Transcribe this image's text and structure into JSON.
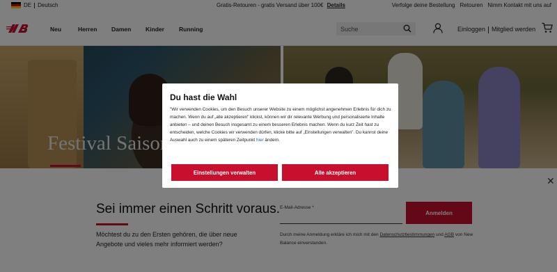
{
  "topbar": {
    "lang_code": "DE",
    "lang_name": "Deutsch",
    "promo_text": "Gratis-Retouren - gratis Versand über 100€",
    "promo_link": "Details",
    "utility": [
      "Verfolge deine Bestellung",
      "Retouren",
      "Nimm Kontakt mit uns auf"
    ]
  },
  "nav": {
    "logo_icon": "new-balance-logo",
    "links": [
      "Neu",
      "Herren",
      "Damen",
      "Kinder",
      "Running"
    ],
    "search_placeholder": "Suche",
    "login": "Einloggen",
    "register": "Mitglied werden"
  },
  "hero": {
    "title": "Festival Saison"
  },
  "newsletter": {
    "title": "Sei immer einen Schritt voraus.",
    "text": "Möchtest du zu den Ersten gehören, die über neue Angebote und vieles mehr informiert werden?",
    "email_label": "E-Mail-Adresse *",
    "button": "Anmelden",
    "legal_prefix": "Durch meine Anmeldung erkläre ich mich mit den ",
    "legal_link1": "Datenschutzbestimmungen",
    "legal_mid": " und ",
    "legal_link2": "AGB",
    "legal_suffix": " von New Balance einverstanden."
  },
  "cookie_modal": {
    "title": "Du hast die Wahl",
    "body_before": "\"Wir verwenden Cookies, um den Besuch unserer Website zu einem möglichst angenehmen Erlebnis für dich zu machen. Wenn du auf „alle akzeptieren\" klickst, können wir dir relevante Werbung und personalisierte Inhalte anbieten – und deinen Besuch insgesamt zu einem besseren Erlebnis machen. Wenn du kurz Zeit hast zu entscheiden, welche Cookies wir verwenden dürfen, klicke bitte auf „Einstellungen verwalten\". Du kannst deine Auswahl auch zu einem späteren Zeitpunkt ",
    "body_link": "hier",
    "body_after": " ändern.",
    "settings_button": "Einstellungen verwalten",
    "accept_button": "Alle akzeptieren"
  },
  "colors": {
    "brand_red": "#c8102e",
    "link_blue": "#1a5ab0"
  }
}
